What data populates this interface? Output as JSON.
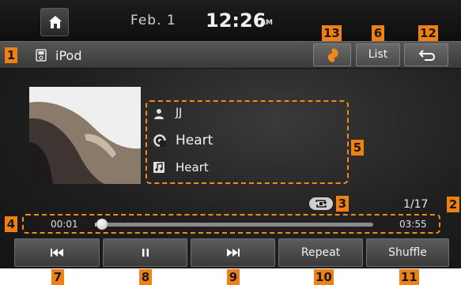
{
  "status_bar": {
    "date": "Feb.  1",
    "time": "12:26",
    "ampm": "AM"
  },
  "title_bar": {
    "source_label": "iPod",
    "list_label": "List"
  },
  "now_playing": {
    "artist": "JJ",
    "album": "Heart",
    "song": "Heart",
    "track_count": "1/17"
  },
  "progress": {
    "elapsed": "00:01",
    "total": "03:55",
    "fraction": 0.004
  },
  "controls": {
    "repeat_label": "Repeat",
    "shuffle_label": "Shuffle"
  },
  "callouts": {
    "c1": "1",
    "c2": "2",
    "c3": "3",
    "c4": "4",
    "c5": "5",
    "c6": "6",
    "c7": "7",
    "c8": "8",
    "c9": "9",
    "c10": "10",
    "c11": "11",
    "c12": "12",
    "c13": "13"
  },
  "colors": {
    "callout": "#f07f14",
    "screen_bg": "#1f1f1f",
    "gracenote_orange": "#f08a1a"
  },
  "icons": {
    "home": "home-icon",
    "source": "ipod-icon",
    "gracenote": "gracenote-icon",
    "back": "back-icon",
    "artist": "person-icon",
    "album": "album-icon",
    "song": "music-note-icon",
    "repeat_indicator": "repeat-icon",
    "prev": "previous-track-icon",
    "pause": "pause-icon",
    "next": "next-track-icon"
  }
}
